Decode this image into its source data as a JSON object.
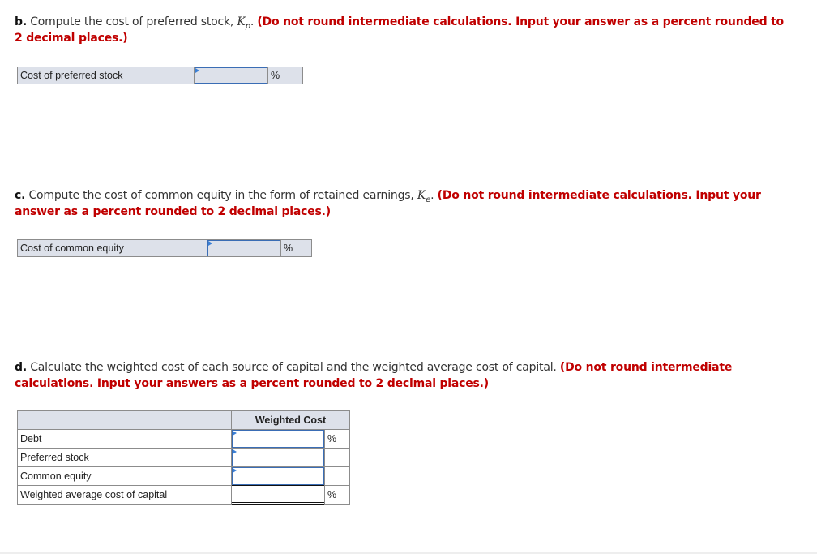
{
  "part_b": {
    "letter": "b.",
    "text": " Compute the cost of preferred stock, ",
    "symbol": "K",
    "subscript": "p",
    "after_symbol": ". ",
    "instruction": "(Do not round intermediate calculations. Input your answer as a percent rounded to 2 decimal places.)",
    "row_label": "Cost of preferred stock",
    "input_value": "",
    "unit": "%"
  },
  "part_c": {
    "letter": "c.",
    "text": " Compute the cost of common equity in the form of retained earnings, ",
    "symbol": "K",
    "subscript": "e",
    "after_symbol": ". ",
    "instruction": "(Do not round intermediate calculations. Input your answer as a percent rounded to 2 decimal places.)",
    "row_label": "Cost of common equity",
    "input_value": "",
    "unit": "%"
  },
  "part_d": {
    "letter": "d.",
    "text": " Calculate the weighted cost of each source of capital and the weighted average cost of capital. ",
    "instruction": "(Do not round intermediate calculations. Input your answers as a percent rounded to 2 decimal places.)",
    "column_header": "Weighted Cost",
    "rows": [
      {
        "label": "Debt",
        "value": "",
        "unit": "%"
      },
      {
        "label": "Preferred stock",
        "value": "",
        "unit": ""
      },
      {
        "label": "Common equity",
        "value": "",
        "unit": ""
      },
      {
        "label": "Weighted average cost of capital",
        "value": "",
        "unit": "%"
      }
    ]
  },
  "colors": {
    "instruction_red": "#c00000",
    "input_border_blue": "#3a6db5",
    "row_fill": "#dde1ea"
  }
}
